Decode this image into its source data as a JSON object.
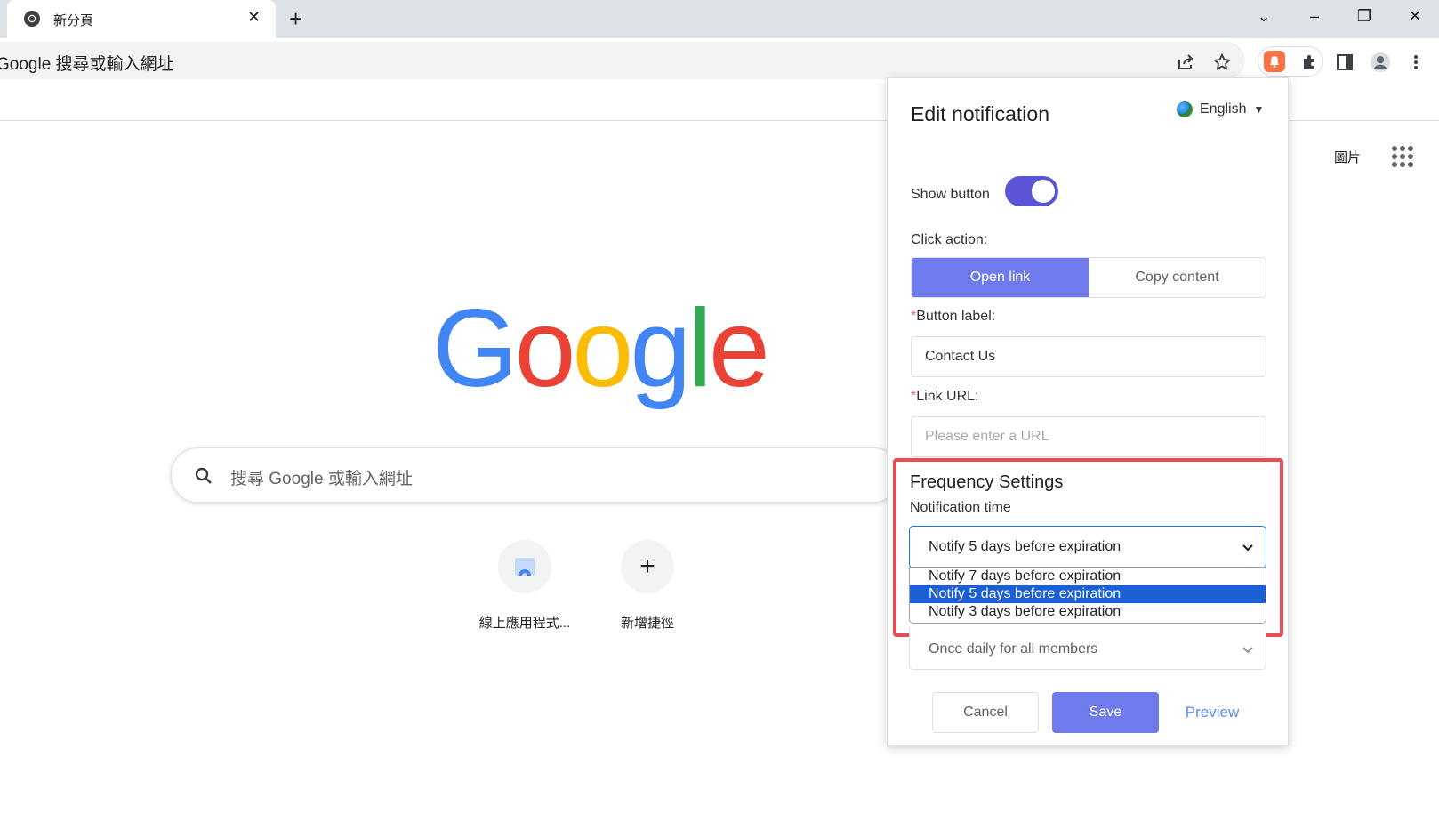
{
  "browser": {
    "tab_title": "新分頁",
    "tab_close": "✕",
    "new_tab": "+",
    "win_controls": {
      "dropdown": "⌄",
      "minimize": "–",
      "restore": "❐",
      "close": "✕"
    },
    "omnibox_text": "Google 搜尋或輸入網址"
  },
  "newtab": {
    "images_link": "圖片",
    "logo": {
      "letters": [
        "G",
        "o",
        "o",
        "g",
        "l",
        "e"
      ],
      "colors": [
        "#4285f4",
        "#ea4335",
        "#fbbc05",
        "#4285f4",
        "#34a853",
        "#ea4335"
      ]
    },
    "search_placeholder": "搜尋 Google 或輸入網址",
    "shortcuts": [
      {
        "label": "線上應用程式..."
      },
      {
        "label": "新增捷徑",
        "icon": "+"
      }
    ]
  },
  "popup": {
    "title": "Edit notification",
    "language": "English",
    "language_caret": "▼",
    "show_button_label": "Show button",
    "show_button_on": true,
    "click_action_label": "Click action:",
    "click_action_options": [
      "Open link",
      "Copy content"
    ],
    "button_label_label": "Button label:",
    "button_label_value": "Contact Us",
    "link_url_label": "Link URL:",
    "link_url_placeholder": "Please enter a URL",
    "required_mark": "*",
    "frequency_title": "Frequency Settings",
    "notification_time_label": "Notification time",
    "notification_time_value": "Notify 5 days before expiration",
    "notification_time_options": [
      "Notify 7 days before expiration",
      "Notify 5 days before expiration",
      "Notify 3 days before expiration"
    ],
    "frequency_value": "Once daily for all members",
    "cancel_label": "Cancel",
    "save_label": "Save",
    "preview_label": "Preview",
    "accent_color": "#6f7bea",
    "highlight_color": "#ea4c53"
  }
}
